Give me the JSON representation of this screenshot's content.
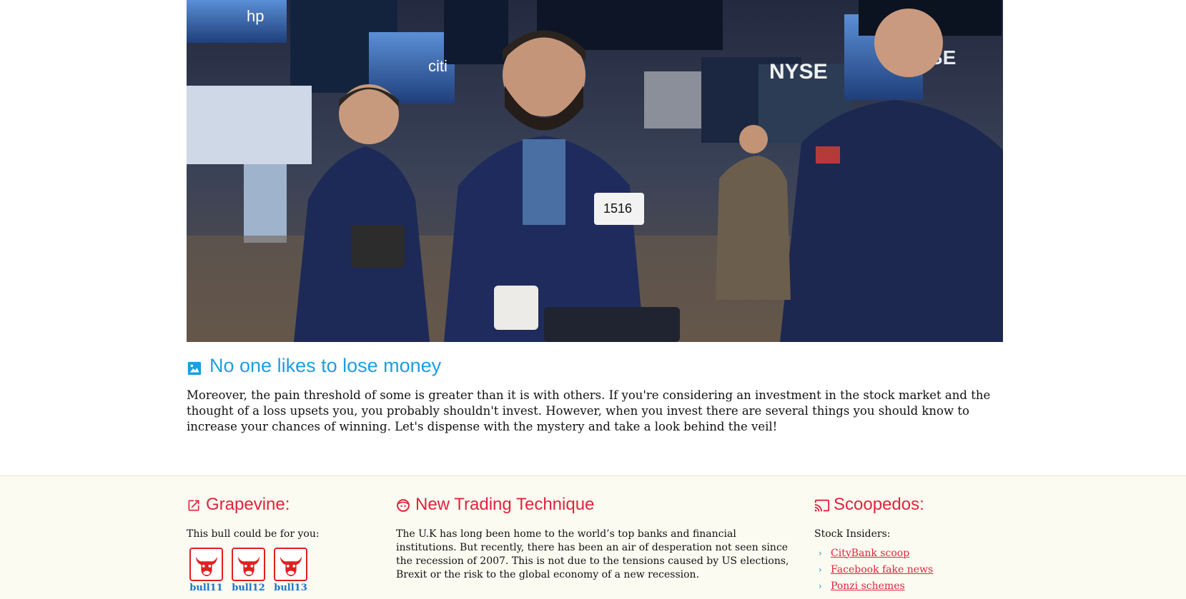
{
  "hero": {
    "image_icon": "trading-floor-photo"
  },
  "article": {
    "title": "No one likes to lose money",
    "title_icon": "image-icon",
    "body": "Moreover, the pain threshold of some is greater than it is with others. If you're considering an investment in the stock market and the thought of a loss upsets you, you probably shouldn't invest. However, when you invest there are several things you should know to increase your chances of winning. Let's dispense with the mystery and take a look behind the veil!",
    "title_color": "#1a9fe0"
  },
  "footer": {
    "background": "#fbfbf1",
    "accent": "#e0243d",
    "grapevine": {
      "title": "Grapevine:",
      "icon": "external-link-icon",
      "text": "This bull could be for you:",
      "bulls": [
        {
          "label": "bull11",
          "icon": "bull-icon"
        },
        {
          "label": "bull12",
          "icon": "bull-icon"
        },
        {
          "label": "bull13",
          "icon": "bull-icon"
        }
      ]
    },
    "technique": {
      "title": "New Trading Technique",
      "icon": "face-icon",
      "text": "The U.K has long been home to the world’s top banks and financial institutions. But recently, there has been an air of desperation not seen since the recession of 2007. This is not due to the tensions caused by US elections, Brexit or the risk to the global economy of a new recession."
    },
    "scoopedos": {
      "title": "Scoopedos:",
      "icon": "cast-icon",
      "text": "Stock Insiders:",
      "links": [
        "CityBank scoop",
        "Facebook fake news",
        "Ponzi schemes"
      ]
    }
  }
}
